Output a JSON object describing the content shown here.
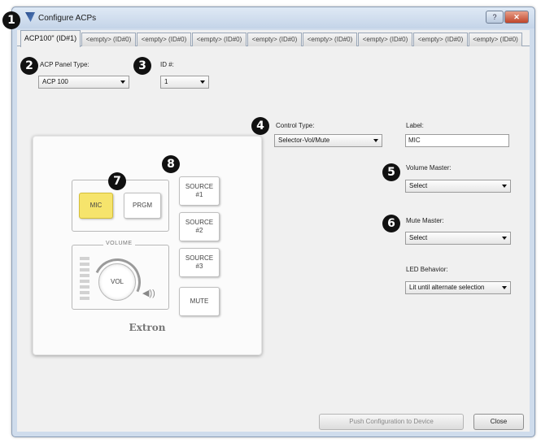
{
  "window": {
    "title": "Configure ACPs",
    "help_label": "?",
    "close_label": "✕"
  },
  "tabs": [
    {
      "label": "ACP100\" (ID#1)",
      "active": true
    },
    {
      "label": "<empty> (ID#0)"
    },
    {
      "label": "<empty> (ID#0)"
    },
    {
      "label": "<empty> (ID#0)"
    },
    {
      "label": "<empty> (ID#0)"
    },
    {
      "label": "<empty> (ID#0)"
    },
    {
      "label": "<empty> (ID#0)"
    },
    {
      "label": "<empty> (ID#0)"
    }
  ],
  "panel_type": {
    "label": "ACP Panel Type:",
    "value": "ACP 100"
  },
  "id": {
    "label": "ID #:",
    "value": "1"
  },
  "control_type": {
    "label": "Control Type:",
    "value": "Selector-Vol/Mute"
  },
  "label_field": {
    "label": "Label:",
    "value": "MIC"
  },
  "volume_master": {
    "label": "Volume Master:",
    "value": "Select"
  },
  "mute_master": {
    "label": "Mute Master:",
    "value": "Select"
  },
  "led_behavior": {
    "label": "LED Behavior:",
    "value": "Lit until alternate selection"
  },
  "hardware": {
    "mic": "MIC",
    "prgm": "PRGM",
    "source1": "SOURCE\n#1",
    "source2": "SOURCE\n#2",
    "source3": "SOURCE\n#3",
    "mute": "MUTE",
    "volume_title": "VOLUME",
    "vol_knob": "VOL",
    "speaker_glyph": "◀))",
    "brand": "Extron"
  },
  "callouts": [
    "1",
    "2",
    "3",
    "4",
    "5",
    "6",
    "7",
    "8"
  ],
  "footer": {
    "push_label": "Push Configuration to Device",
    "close_label": "Close"
  },
  "colors": {
    "lit_button": "#f6e46c",
    "window_frame": "#cfdcec",
    "client_bg": "#f0f0f0"
  }
}
